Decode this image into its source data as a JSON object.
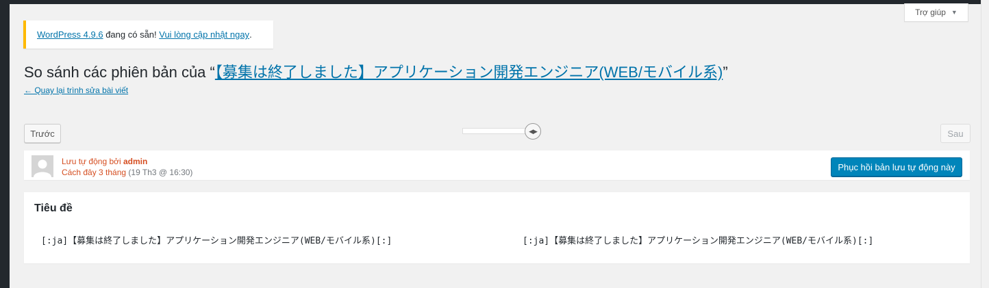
{
  "help_tab": {
    "label": "Trợ giúp"
  },
  "notice": {
    "version_link": "WordPress 4.9.6",
    "middle_text": " đang có sẵn! ",
    "update_link": "Vui lòng cập nhật ngay",
    "trailing": "."
  },
  "title": {
    "prefix": "So sánh các phiên bản của “",
    "post_title": "【募集は終了しました】アプリケーション開発エンジニア(WEB/モバイル系)",
    "suffix": "”"
  },
  "back_link": "← Quay lại trình sửa bài viết",
  "nav": {
    "prev": "Trước",
    "next": "Sau"
  },
  "revision": {
    "autosave_label": "Lưu tự động bởi ",
    "author": "admin",
    "relative_time": "Cách đây 3 tháng",
    "date": " (19 Th3 @ 16:30)",
    "restore_button": "Phục hồi bản lưu tự động này"
  },
  "diff": {
    "field": "Tiêu đề",
    "left": "[:ja]【募集は終了しました】アプリケーション開発エンジニア(WEB/モバイル系)[:]",
    "right": "[:ja]【募集は終了しました】アプリケーション開発エンジニア(WEB/モバイル系)[:]"
  }
}
